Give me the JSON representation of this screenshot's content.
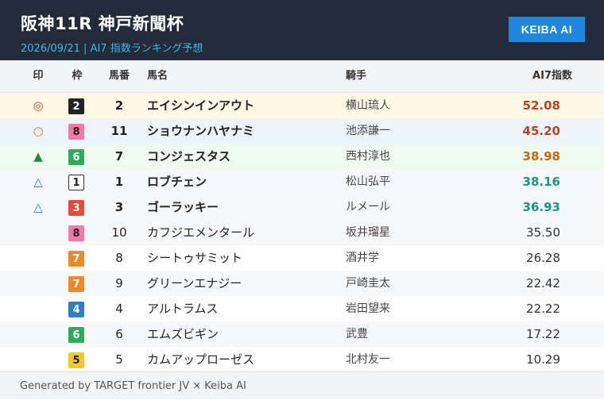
{
  "header": {
    "title": "阪神11R  神戸新聞杯",
    "subtitle": "2026/09/21  |  AI7 指数ランキング予想",
    "brand": "KEIBA AI"
  },
  "table": {
    "columns": {
      "mark": "印",
      "waku": "枠",
      "umaban": "馬番",
      "name": "馬名",
      "jockey": "騎手",
      "score": "AI7指数"
    },
    "rows": [
      {
        "mark": "◎",
        "mark_color": "#d4462a",
        "waku": "2",
        "waku_bg": "#222222",
        "waku_fg": "#ffffff",
        "waku_border": "#222222",
        "umaban": "2",
        "name": "エイシンインアウト",
        "jockey": "横山琉人",
        "score": "52.08",
        "score_color": "#b8431f",
        "bg": "#fef8e4",
        "top": true
      },
      {
        "mark": "○",
        "mark_color": "#e26b1c",
        "waku": "8",
        "waku_bg": "#f07aa8",
        "waku_fg": "#222222",
        "waku_border": "#f07aa8",
        "umaban": "11",
        "name": "ショウナンハヤナミ",
        "jockey": "池添謙一",
        "score": "45.20",
        "score_color": "#b8431f",
        "bg": "#eef4fd",
        "top": true
      },
      {
        "mark": "▲",
        "mark_color": "#1f8f3a",
        "waku": "6",
        "waku_bg": "#2eaa5a",
        "waku_fg": "#ffffff",
        "waku_border": "#2eaa5a",
        "umaban": "7",
        "name": "コンジェスタス",
        "jockey": "西村淳也",
        "score": "38.98",
        "score_color": "#c06a12",
        "bg": "#effaf1",
        "top": true
      },
      {
        "mark": "△",
        "mark_color": "#2e7fb8",
        "waku": "1",
        "waku_bg": "#ffffff",
        "waku_fg": "#222222",
        "waku_border": "#333333",
        "umaban": "1",
        "name": "ロブチェン",
        "jockey": "松山弘平",
        "score": "38.16",
        "score_color": "#16967f",
        "bg": "#f7f8fa",
        "top": true
      },
      {
        "mark": "△",
        "mark_color": "#2e7fb8",
        "waku": "3",
        "waku_bg": "#e34b3a",
        "waku_fg": "#ffffff",
        "waku_border": "#e34b3a",
        "umaban": "3",
        "name": "ゴーラッキー",
        "jockey": "ルメール",
        "score": "36.93",
        "score_color": "#16967f",
        "bg": "#f7f8fa",
        "top": true
      },
      {
        "mark": "",
        "mark_color": "#222222",
        "waku": "8",
        "waku_bg": "#f07aa8",
        "waku_fg": "#222222",
        "waku_border": "#f07aa8",
        "umaban": "10",
        "name": "カフジエメンタール",
        "jockey": "坂井瑠星",
        "score": "35.50",
        "score_color": "#333333",
        "bg": "#f7f8fa",
        "top": false
      },
      {
        "mark": "",
        "mark_color": "#222222",
        "waku": "7",
        "waku_bg": "#ea8a2a",
        "waku_fg": "#ffffff",
        "waku_border": "#ea8a2a",
        "umaban": "8",
        "name": "シートゥサミット",
        "jockey": "酒井学",
        "score": "26.28",
        "score_color": "#333333",
        "bg": "#ffffff",
        "top": false
      },
      {
        "mark": "",
        "mark_color": "#222222",
        "waku": "7",
        "waku_bg": "#ea8a2a",
        "waku_fg": "#ffffff",
        "waku_border": "#ea8a2a",
        "umaban": "9",
        "name": "グリーンエナジー",
        "jockey": "戸崎圭太",
        "score": "22.42",
        "score_color": "#333333",
        "bg": "#f7f8fa",
        "top": false
      },
      {
        "mark": "",
        "mark_color": "#222222",
        "waku": "4",
        "waku_bg": "#2f7fc2",
        "waku_fg": "#ffffff",
        "waku_border": "#2f7fc2",
        "umaban": "4",
        "name": "アルトラムス",
        "jockey": "岩田望来",
        "score": "22.22",
        "score_color": "#333333",
        "bg": "#ffffff",
        "top": false
      },
      {
        "mark": "",
        "mark_color": "#222222",
        "waku": "6",
        "waku_bg": "#2eaa5a",
        "waku_fg": "#ffffff",
        "waku_border": "#2eaa5a",
        "umaban": "6",
        "name": "エムズビギン",
        "jockey": "武豊",
        "score": "17.22",
        "score_color": "#333333",
        "bg": "#f7f8fa",
        "top": false
      },
      {
        "mark": "",
        "mark_color": "#222222",
        "waku": "5",
        "waku_bg": "#f3c92a",
        "waku_fg": "#222222",
        "waku_border": "#f3c92a",
        "umaban": "5",
        "name": "カムアップローゼス",
        "jockey": "北村友一",
        "score": "10.29",
        "score_color": "#333333",
        "bg": "#ffffff",
        "top": false
      }
    ]
  },
  "footer": {
    "text": "Generated by TARGET frontier JV × Keiba AI"
  }
}
